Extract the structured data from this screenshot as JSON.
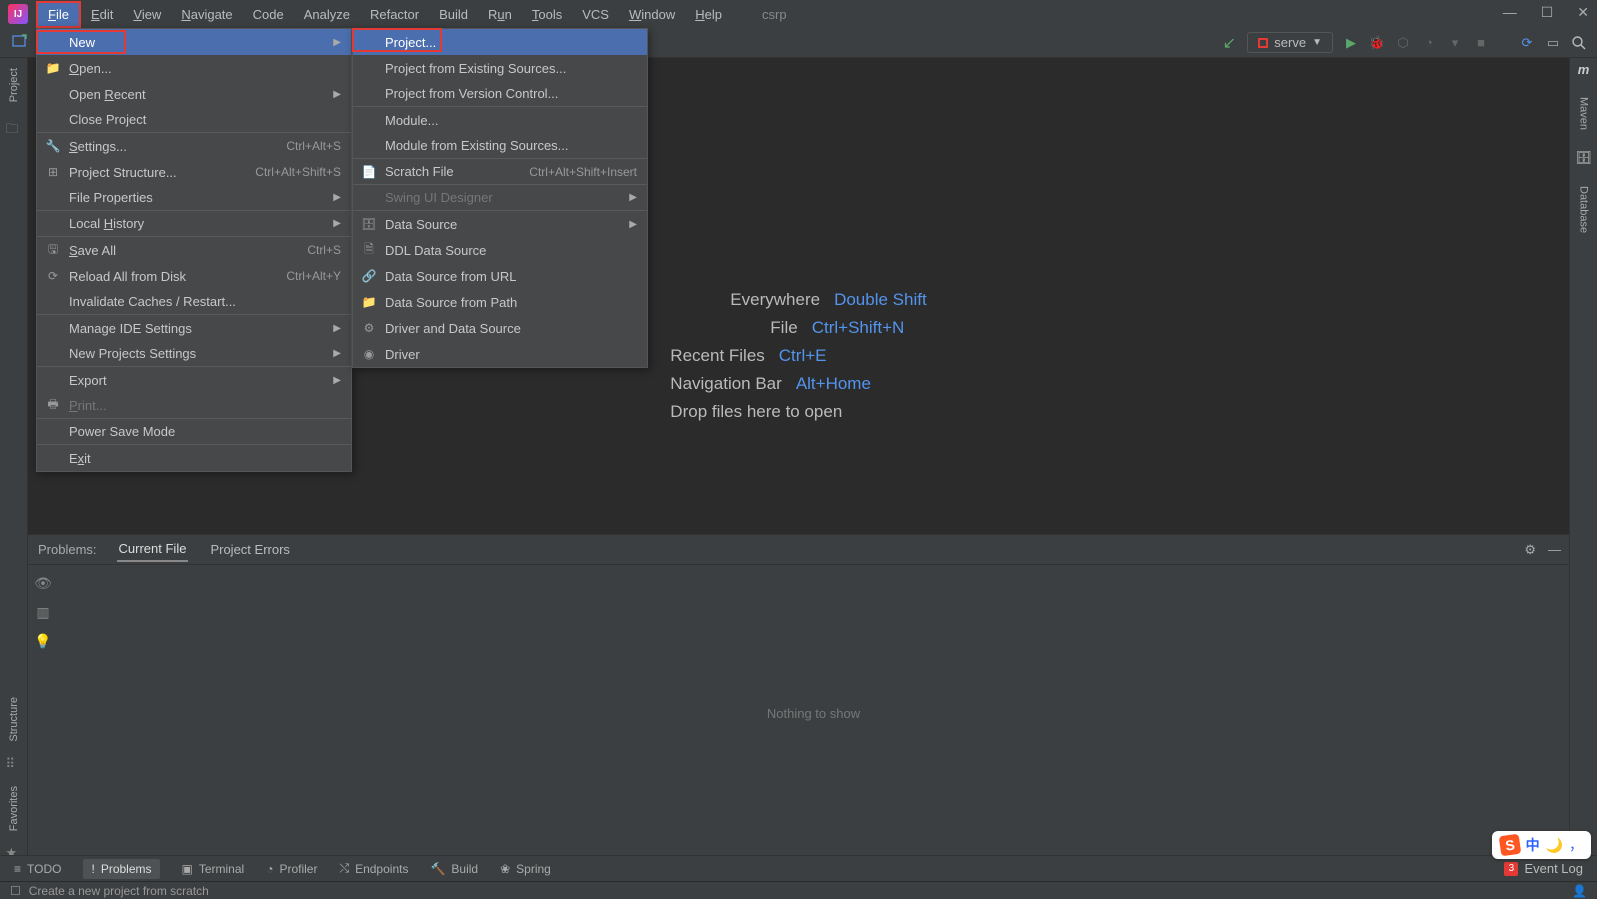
{
  "menubar": {
    "items": [
      "File",
      "Edit",
      "View",
      "Navigate",
      "Code",
      "Analyze",
      "Refactor",
      "Build",
      "Run",
      "Tools",
      "VCS",
      "Window",
      "Help"
    ],
    "underlines": [
      "F",
      "E",
      "V",
      "N",
      "",
      "",
      "",
      "",
      "u",
      "T",
      "",
      "W",
      "H"
    ]
  },
  "project_name": "csrp",
  "run_config_label": "serve",
  "file_menu": [
    {
      "label": "New",
      "arrow": true,
      "highlighted": true
    },
    {
      "label": "Open...",
      "icon": "folder",
      "sep": false,
      "ul": "O"
    },
    {
      "label": "Open Recent",
      "arrow": true,
      "ul": "R",
      "pos": 5
    },
    {
      "label": "Close Project",
      "sep": true
    },
    {
      "label": "Settings...",
      "icon": "wrench",
      "shortcut": "Ctrl+Alt+S",
      "ul": "S"
    },
    {
      "label": "Project Structure...",
      "icon": "struct",
      "shortcut": "Ctrl+Alt+Shift+S"
    },
    {
      "label": "File Properties",
      "arrow": true,
      "sep": true
    },
    {
      "label": "Local History",
      "arrow": true,
      "sep": true,
      "ul": "H",
      "pos": 6
    },
    {
      "label": "Save All",
      "icon": "save",
      "shortcut": "Ctrl+S",
      "ul": "S"
    },
    {
      "label": "Reload All from Disk",
      "icon": "reload",
      "shortcut": "Ctrl+Alt+Y"
    },
    {
      "label": "Invalidate Caches / Restart...",
      "sep": true
    },
    {
      "label": "Manage IDE Settings",
      "arrow": true
    },
    {
      "label": "New Projects Settings",
      "arrow": true,
      "sep": true
    },
    {
      "label": "Export",
      "arrow": true
    },
    {
      "label": "Print...",
      "disabled": true,
      "icon": "print",
      "sep": true,
      "ul": "P"
    },
    {
      "label": "Power Save Mode",
      "sep": true
    },
    {
      "label": "Exit",
      "ul": "x",
      "pos": 1
    }
  ],
  "new_submenu": [
    {
      "label": "Project...",
      "highlighted": true
    },
    {
      "label": "Project from Existing Sources..."
    },
    {
      "label": "Project from Version Control...",
      "sep": true
    },
    {
      "label": "Module..."
    },
    {
      "label": "Module from Existing Sources...",
      "sep": true
    },
    {
      "label": "Scratch File",
      "icon": "scratch",
      "shortcut": "Ctrl+Alt+Shift+Insert",
      "sep": true
    },
    {
      "label": "Swing UI Designer",
      "arrow": true,
      "disabled": true,
      "sep": true
    },
    {
      "label": "Data Source",
      "icon": "db",
      "arrow": true
    },
    {
      "label": "DDL Data Source",
      "icon": "ddl"
    },
    {
      "label": "Data Source from URL",
      "icon": "url"
    },
    {
      "label": "Data Source from Path",
      "icon": "folder"
    },
    {
      "label": "Driver and Data Source",
      "icon": "driver"
    },
    {
      "label": "Driver",
      "icon": "driver2"
    }
  ],
  "welcome": [
    {
      "label": "Search Everywhere",
      "shortcut": "Double Shift",
      "clip": true
    },
    {
      "label": "Go to File",
      "shortcut": "Ctrl+Shift+N",
      "clip": true
    },
    {
      "label": "Recent Files",
      "shortcut": "Ctrl+E"
    },
    {
      "label": "Navigation Bar",
      "shortcut": "Alt+Home"
    },
    {
      "label": "Drop files here to open",
      "shortcut": ""
    }
  ],
  "problems": {
    "title": "Problems:",
    "tabs": [
      "Current File",
      "Project Errors"
    ],
    "empty": "Nothing to show"
  },
  "bottom_tabs": [
    {
      "label": "TODO",
      "icon": "≡"
    },
    {
      "label": "Problems",
      "icon": "!",
      "active": true
    },
    {
      "label": "Terminal",
      "icon": "▣"
    },
    {
      "label": "Profiler",
      "icon": "◔"
    },
    {
      "label": "Endpoints",
      "icon": "⤭"
    },
    {
      "label": "Build",
      "icon": "🔨"
    },
    {
      "label": "Spring",
      "icon": "❀"
    }
  ],
  "event_log": "Event Log",
  "statusbar_text": "Create a new project from scratch",
  "left_tabs": [
    "Project"
  ],
  "right_tabs": [
    "Maven",
    "Database"
  ],
  "left_bottom_tabs": [
    "Structure",
    "Favorites"
  ],
  "ime": {
    "s": "S",
    "zh": "中",
    "comma": "，"
  }
}
